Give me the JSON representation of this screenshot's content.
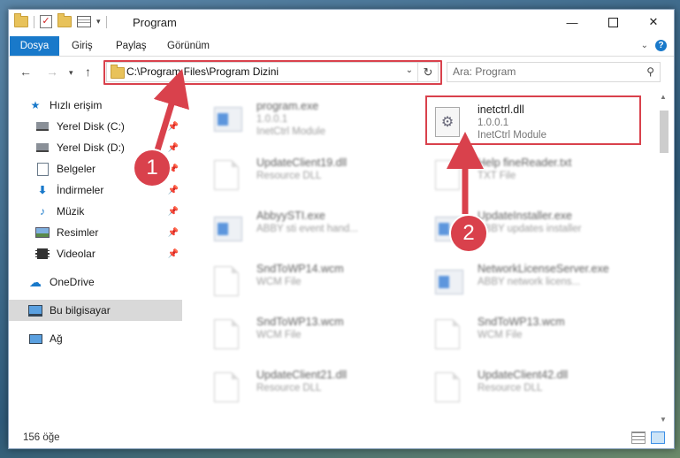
{
  "window": {
    "title": "Program",
    "minimize_icon": "minimize-icon",
    "maximize_icon": "maximize-icon",
    "close_icon": "close-icon"
  },
  "ribbon": {
    "tabs": [
      "Dosya",
      "Giriş",
      "Paylaş",
      "Görünüm"
    ],
    "help": "?"
  },
  "address": {
    "path": "C:\\Program Files\\Program Dizini",
    "search_placeholder": "Ara: Program"
  },
  "nav_pane": {
    "quick_access": "Hızlı erişim",
    "pinned": [
      "Yerel Disk (C:)",
      "Yerel Disk (D:)",
      "Belgeler",
      "İndirmeler",
      "Müzik",
      "Resimler",
      "Videolar"
    ],
    "onedrive": "OneDrive",
    "this_pc": "Bu bilgisayar",
    "network": "Ağ"
  },
  "files": [
    {
      "name": "program.exe",
      "line1": "1.0.0.1",
      "line2": "InetCtrl Module",
      "icon": "app-icon",
      "blurred": true
    },
    {
      "name": "inetctrl.dll",
      "line1": "1.0.0.1",
      "line2": "InetCtrl Module",
      "icon": "dll-gear-icon",
      "blurred": false
    },
    {
      "name": "UpdateClient19.dll",
      "line1": "Resource DLL",
      "line2": "",
      "icon": "document-icon",
      "blurred": true
    },
    {
      "name": "Help fineReader.txt",
      "line1": "TXT File",
      "line2": "",
      "icon": "document-icon",
      "blurred": true
    },
    {
      "name": "AbbyySTI.exe",
      "line1": "ABBY sti event hand...",
      "line2": "",
      "icon": "app-icon",
      "blurred": true
    },
    {
      "name": "UpdateInstaller.exe",
      "line1": "ABBY updates installer",
      "line2": "",
      "icon": "app-icon",
      "blurred": true
    },
    {
      "name": "SndToWP14.wcm",
      "line1": "WCM File",
      "line2": "",
      "icon": "document-icon",
      "blurred": true
    },
    {
      "name": "NetworkLicenseServer.exe",
      "line1": "ABBY network licens...",
      "line2": "",
      "icon": "app-icon",
      "blurred": true
    },
    {
      "name": "SndToWP13.wcm",
      "line1": "WCM File",
      "line2": "",
      "icon": "document-icon",
      "blurred": true
    },
    {
      "name": "SndToWP13.wcm",
      "line1": "WCM File",
      "line2": "",
      "icon": "document-icon",
      "blurred": true
    },
    {
      "name": "UpdateClient21.dll",
      "line1": "Resource DLL",
      "line2": "",
      "icon": "document-icon",
      "blurred": true
    },
    {
      "name": "UpdateClient42.dll",
      "line1": "Resource DLL",
      "line2": "",
      "icon": "document-icon",
      "blurred": true
    }
  ],
  "status": {
    "count": "156 öğe"
  },
  "annotations": {
    "step1": "1",
    "step2": "2",
    "color": "#d9414c"
  }
}
